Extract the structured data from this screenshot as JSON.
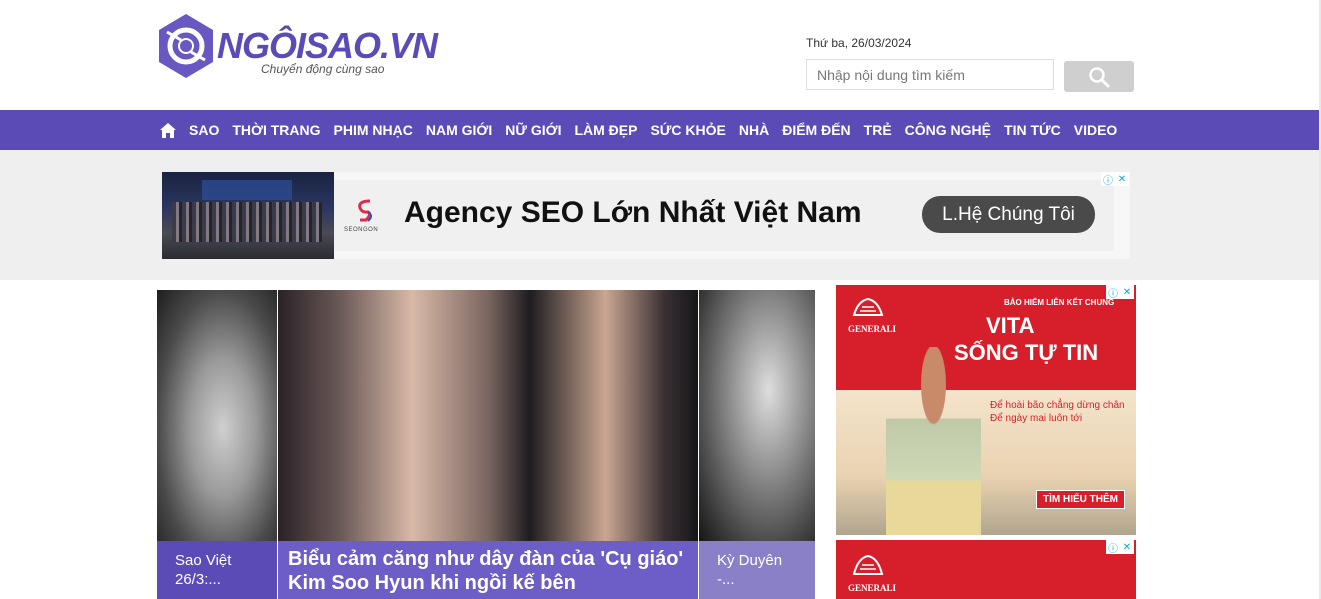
{
  "header": {
    "logo_text": "NGÔISAO.VN",
    "tagline": "Chuyển động cùng sao",
    "date": "Thứ ba, 26/03/2024",
    "search_placeholder": "Nhập nội dung tìm kiếm"
  },
  "nav": {
    "items": [
      "SAO",
      "THỜI TRANG",
      "PHIM NHẠC",
      "NAM GIỚI",
      "NỮ GIỚI",
      "LÀM ĐẸP",
      "SỨC KHỎE",
      "NHÀ",
      "ĐIỂM ĐẾN",
      "TRẺ",
      "CÔNG NGHỆ",
      "TIN TỨC",
      "VIDEO"
    ]
  },
  "banner": {
    "brand": "SEONGON",
    "title": "Agency SEO Lớn Nhất Việt Nam",
    "cta": "L.Hệ Chúng Tôi"
  },
  "stories": {
    "left_caption": "Sao Việt 26/3:...",
    "main_caption": "Biểu cảm căng như dây đàn của 'Cụ giáo' Kim Soo Hyun khi ngồi kế bên",
    "right_caption": "Kỳ Duyên -..."
  },
  "ads": {
    "ad1_tag": "BẢO HIỂM LIÊN KẾT CHUNG",
    "ad1_title1": "VITA",
    "ad1_title2": "SỐNG TỰ TIN",
    "ad1_sub1": "Để hoài bão chẳng dừng chân",
    "ad1_sub2": "Để ngày mai luôn tới",
    "ad1_cta": "TÌM HIỂU THÊM",
    "generali": "GENERALI",
    "colors": {
      "nav": "#5b4bb7",
      "ad_red": "#d71f2b"
    }
  }
}
